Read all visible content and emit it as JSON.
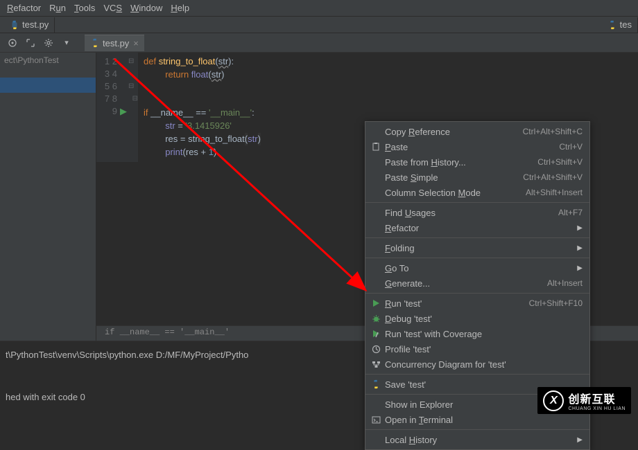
{
  "menu": {
    "items": [
      "Refactor",
      "Run",
      "Tools",
      "VCS",
      "Window",
      "Help"
    ]
  },
  "tabs": {
    "main": "test.py",
    "right": "tes"
  },
  "editor_tab": "test.py",
  "sidebar": {
    "crumb": "ect\\PythonTest"
  },
  "code": {
    "lines": [
      "1",
      "2",
      "3",
      "4",
      "5",
      "6",
      "7",
      "8",
      "9"
    ],
    "l1_def": "def ",
    "l1_fn": "string_to_float",
    "l1_open": "(",
    "l1_param": "str",
    "l1_close": "):",
    "l2_ret": "return ",
    "l2_float": "float",
    "l2_open": "(",
    "l2_str": "str",
    "l2_close": ")",
    "l5_if": "if ",
    "l5_name": "__name__",
    "l5_eq": " == ",
    "l5_main": "'__main__'",
    "l5_colon": ":",
    "l6_str": "str",
    "l6_eq": " = ",
    "l6_val": "'3.1415926'",
    "l7_res": "res",
    "l7_eq": " = ",
    "l7_fn": "string_to_float",
    "l7_open": "(",
    "l7_arg": "str",
    "l7_close": ")",
    "l8_print": "print",
    "l8_open": "(",
    "l8_res": "res",
    "l8_plus": " + ",
    "l8_one": "1",
    "l8_close": ")"
  },
  "breadcrumb": "if __name__ == '__main__'",
  "console": {
    "line1": "t\\PythonTest\\venv\\Scripts\\python.exe D:/MF/MyProject/Pytho",
    "line2": "hed with exit code 0"
  },
  "context_menu": [
    {
      "type": "item",
      "label": "Copy Reference",
      "shortcut": "Ctrl+Alt+Shift+C",
      "ul": 5
    },
    {
      "type": "item",
      "label": "Paste",
      "shortcut": "Ctrl+V",
      "icon": "paste",
      "ul": 0
    },
    {
      "type": "item",
      "label": "Paste from History...",
      "shortcut": "Ctrl+Shift+V",
      "ul": 11
    },
    {
      "type": "item",
      "label": "Paste Simple",
      "shortcut": "Ctrl+Alt+Shift+V",
      "ul": 6
    },
    {
      "type": "item",
      "label": "Column Selection Mode",
      "shortcut": "Alt+Shift+Insert",
      "ul": 17
    },
    {
      "type": "sep"
    },
    {
      "type": "item",
      "label": "Find Usages",
      "shortcut": "Alt+F7",
      "ul": 5
    },
    {
      "type": "item",
      "label": "Refactor",
      "submenu": true,
      "ul": 0
    },
    {
      "type": "sep"
    },
    {
      "type": "item",
      "label": "Folding",
      "submenu": true,
      "ul": 0
    },
    {
      "type": "sep"
    },
    {
      "type": "item",
      "label": "Go To",
      "submenu": true,
      "ul": 0
    },
    {
      "type": "item",
      "label": "Generate...",
      "shortcut": "Alt+Insert",
      "ul": 0
    },
    {
      "type": "sep"
    },
    {
      "type": "item",
      "label": "Run 'test'",
      "shortcut": "Ctrl+Shift+F10",
      "icon": "run",
      "ul": 0
    },
    {
      "type": "item",
      "label": "Debug 'test'",
      "icon": "debug",
      "ul": 0
    },
    {
      "type": "item",
      "label": "Run 'test' with Coverage",
      "icon": "coverage"
    },
    {
      "type": "item",
      "label": "Profile 'test'",
      "icon": "profile"
    },
    {
      "type": "item",
      "label": "Concurrency Diagram for 'test'",
      "icon": "concurrency"
    },
    {
      "type": "sep"
    },
    {
      "type": "item",
      "label": "Save 'test'",
      "icon": "python"
    },
    {
      "type": "sep"
    },
    {
      "type": "item",
      "label": "Show in Explorer"
    },
    {
      "type": "item",
      "label": "Open in Terminal",
      "icon": "terminal",
      "ul": 8
    },
    {
      "type": "sep"
    },
    {
      "type": "item",
      "label": "Local History",
      "submenu": true,
      "ul": 6
    }
  ],
  "watermark": {
    "main": "创新互联",
    "sub": "CHUANG XIN HU LIAN"
  }
}
